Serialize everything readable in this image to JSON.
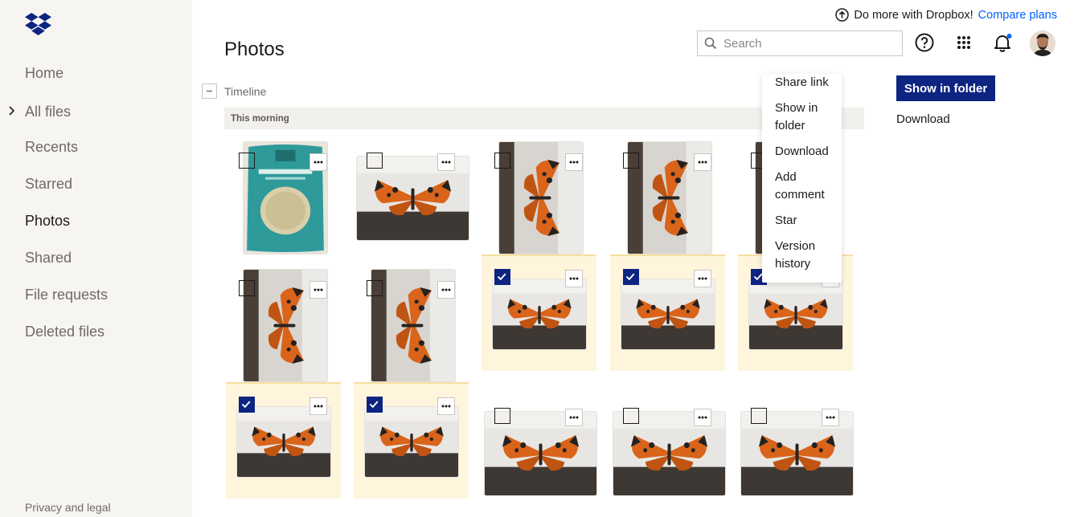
{
  "promo": {
    "text": "Do more with Dropbox!",
    "link": "Compare plans"
  },
  "page_title": "Photos",
  "search": {
    "placeholder": "Search",
    "value": ""
  },
  "sidebar": {
    "items": [
      {
        "label": "Home",
        "active": false
      },
      {
        "label": "All files",
        "active": false,
        "has_chevron": true
      },
      {
        "label": "Recents",
        "active": false
      },
      {
        "label": "Starred",
        "active": false
      },
      {
        "label": "Photos",
        "active": true
      },
      {
        "label": "Shared",
        "active": false
      },
      {
        "label": "File requests",
        "active": false
      },
      {
        "label": "Deleted files",
        "active": false
      }
    ],
    "footer": "Privacy and legal"
  },
  "header_icons": [
    "help-icon",
    "apps-grid-icon",
    "notification-bell-icon",
    "avatar"
  ],
  "timeline": {
    "label": "Timeline",
    "section": "This morning"
  },
  "photos": [
    {
      "subject": "ashwagandha-package",
      "selected": false,
      "orientation": "portrait"
    },
    {
      "subject": "butterfly",
      "selected": false,
      "orientation": "landscape"
    },
    {
      "subject": "butterfly",
      "selected": false,
      "orientation": "portrait"
    },
    {
      "subject": "butterfly",
      "selected": false,
      "orientation": "portrait"
    },
    {
      "subject": "butterfly",
      "selected": false,
      "orientation": "portrait"
    },
    {
      "subject": "butterfly",
      "selected": false,
      "orientation": "portrait"
    },
    {
      "subject": "butterfly",
      "selected": false,
      "orientation": "portrait"
    },
    {
      "subject": "butterfly",
      "selected": true,
      "orientation": "landscape"
    },
    {
      "subject": "butterfly",
      "selected": true,
      "orientation": "landscape"
    },
    {
      "subject": "butterfly",
      "selected": true,
      "orientation": "landscape"
    },
    {
      "subject": "butterfly",
      "selected": true,
      "orientation": "landscape"
    },
    {
      "subject": "butterfly",
      "selected": true,
      "orientation": "landscape"
    },
    {
      "subject": "butterfly",
      "selected": false,
      "orientation": "landscape"
    },
    {
      "subject": "butterfly",
      "selected": false,
      "orientation": "landscape"
    },
    {
      "subject": "butterfly",
      "selected": false,
      "orientation": "landscape"
    }
  ],
  "context_menu": {
    "items": [
      "Share link",
      "Show in folder",
      "Download",
      "Add comment",
      "Star",
      "Version history"
    ]
  },
  "actions": {
    "primary": "Show in folder",
    "secondary": "Download"
  },
  "colors": {
    "accent": "#0061fe",
    "primary_button": "#0d2481",
    "selected_bg": "#fff5dc",
    "sidebar_bg": "#f7f5f2"
  }
}
